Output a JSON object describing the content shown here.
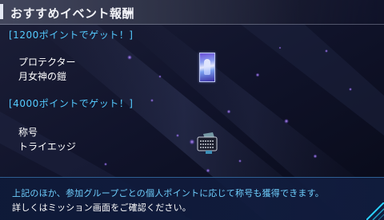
{
  "header": {
    "title": "おすすめイベント報酬"
  },
  "rewards": [
    {
      "condition": "[1200ポイントでゲット！]",
      "category": "プロテクター",
      "item": "月女神の鎧"
    },
    {
      "condition": "[4000ポイントでゲット！]",
      "category": "称号",
      "item": "トライエッジ"
    }
  ],
  "notice": {
    "line1": "上記のほか、参加グループごとの個人ポイントに応じて称号も獲得できます。",
    "line2": "詳しくはミッション画面をご確認ください。"
  },
  "colors": {
    "accent_cyan": "#54cbff",
    "notice_highlight": "#6fd0ff",
    "background": "#0c0e1e"
  },
  "icons": {
    "card_thumbnail": "protector-card-icon",
    "title_plate": "title-plate-icon"
  }
}
